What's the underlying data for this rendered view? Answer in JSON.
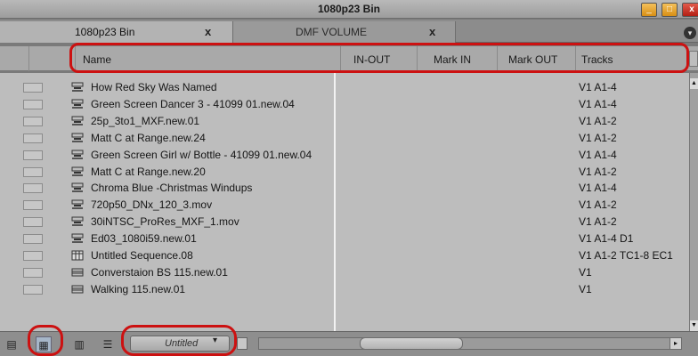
{
  "window": {
    "title": "1080p23 Bin",
    "min_label": "_",
    "max_label": "□",
    "close_label": "x"
  },
  "tabs": [
    {
      "label": "1080p23 Bin",
      "close": "x",
      "active": true
    },
    {
      "label": "DMF VOLUME",
      "close": "x",
      "active": false
    }
  ],
  "tab_menu_icon": "▾",
  "header": {
    "name": "Name",
    "inout": "IN-OUT",
    "markin": "Mark IN",
    "markout": "Mark OUT",
    "tracks": "Tracks"
  },
  "rows": [
    {
      "icon": "sequence-icon",
      "name": "How Red Sky Was Named",
      "tracks": "V1 A1-4"
    },
    {
      "icon": "sequence-icon",
      "name": "Green Screen Dancer 3 - 41099 01.new.04",
      "tracks": "V1 A1-4"
    },
    {
      "icon": "sequence-icon",
      "name": "25p_3to1_MXF.new.01",
      "tracks": "V1 A1-2"
    },
    {
      "icon": "sequence-icon",
      "name": "Matt C at Range.new.24",
      "tracks": "V1 A1-2"
    },
    {
      "icon": "sequence-icon",
      "name": "Green Screen Girl w/ Bottle - 41099 01.new.04",
      "tracks": "V1 A1-4"
    },
    {
      "icon": "sequence-icon",
      "name": "Matt C at Range.new.20",
      "tracks": "V1 A1-2"
    },
    {
      "icon": "sequence-icon",
      "name": "Chroma Blue -Christmas Windups",
      "tracks": "V1 A1-4"
    },
    {
      "icon": "sequence-icon",
      "name": "720p50_DNx_120_3.mov",
      "tracks": "V1 A1-2"
    },
    {
      "icon": "sequence-icon",
      "name": "30iNTSC_ProRes_MXF_1.mov",
      "tracks": "V1 A1-2"
    },
    {
      "icon": "sequence-icon",
      "name": "Ed03_1080i59.new.01",
      "tracks": "V1 A1-4 D1"
    },
    {
      "icon": "sequence-table-icon",
      "name": "Untitled Sequence.08",
      "tracks": "V1 A1-2 TC1-8 EC1"
    },
    {
      "icon": "clip-icon",
      "name": "Converstaion BS 115.new.01",
      "tracks": "V1"
    },
    {
      "icon": "clip-icon",
      "name": "Walking 115.new.01",
      "tracks": "V1"
    }
  ],
  "bottom": {
    "view_select": "Untitled",
    "view_arrow": "▾",
    "scroll_right": "▸"
  },
  "colors": {
    "highlight_ring": "#cc1111",
    "selected_view": "#a6b6c8"
  }
}
